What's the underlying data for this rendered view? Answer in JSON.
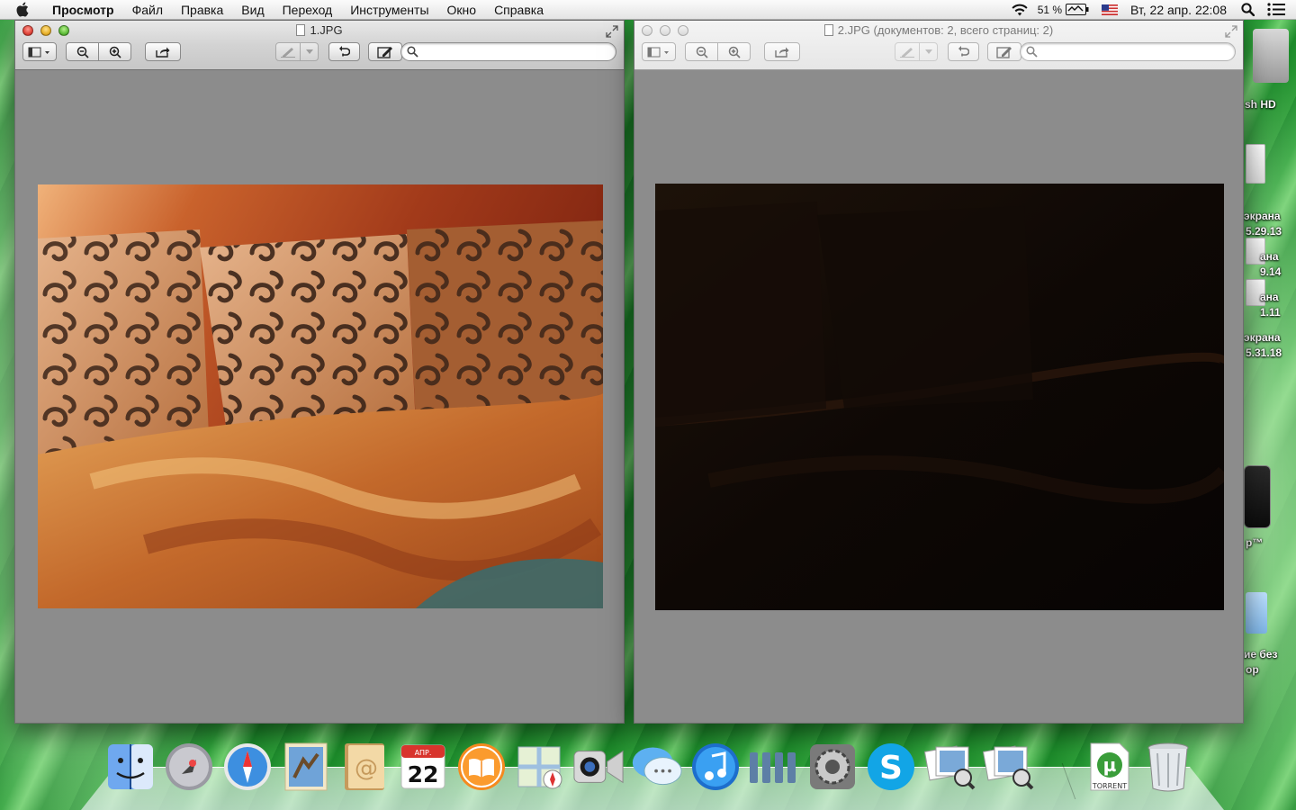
{
  "menubar": {
    "app_name": "Просмотр",
    "menus": [
      "Файл",
      "Правка",
      "Вид",
      "Переход",
      "Инструменты",
      "Окно",
      "Справка"
    ],
    "battery_percent": "51 %",
    "clock": "Вт, 22 апр.  22:08"
  },
  "desktop": {
    "labels": [
      "sh HD",
      "экрана",
      "5.29.13",
      "ана",
      "9.14",
      "ана",
      "1.11",
      "экрана",
      "5.31.18",
      "р™",
      "ие без",
      "ор"
    ]
  },
  "window1": {
    "title": "1.JPG",
    "search_placeholder": ""
  },
  "window2": {
    "title": "2.JPG (документов: 2, всего страниц: 2)",
    "search_placeholder": ""
  },
  "dock": {
    "items": [
      "finder-icon",
      "launchpad-icon",
      "safari-icon",
      "mail-icon",
      "contacts-icon",
      "calendar-icon",
      "ibooks-icon",
      "maps-icon",
      "facetime-icon",
      "messages-icon",
      "itunes-icon",
      "equalizer-app-icon",
      "system-preferences-icon",
      "skype-icon",
      "preview-icon",
      "preview-2-icon",
      "utorrent-icon",
      "trash-icon"
    ],
    "calendar_month": "АПР.",
    "calendar_day": "22",
    "utorrent_label": "TORRENT"
  },
  "colors": {
    "window_background": "#8c8c8c",
    "desktop_green": "#2ea13a"
  }
}
